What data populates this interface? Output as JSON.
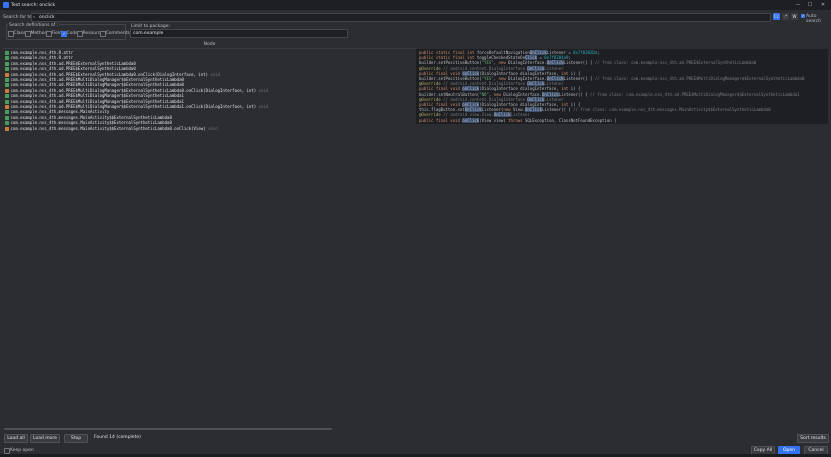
{
  "window": {
    "title": "Text search: onclick",
    "minimize": "—",
    "maximize": "☐",
    "close": "✕"
  },
  "search": {
    "label": "Search for text:",
    "value": "onclick",
    "case_btn": "Cc",
    "regex_btn": ".*",
    "words_btn": "W",
    "auto_search_label": "Auto search",
    "auto_search_checked": true
  },
  "definitions": {
    "legend": "Search definitions of :",
    "options": [
      {
        "label": "Class",
        "checked": false
      },
      {
        "label": "Method",
        "checked": false
      },
      {
        "label": "Field",
        "checked": false
      },
      {
        "label": "Code",
        "checked": true
      },
      {
        "label": "Resource",
        "checked": false
      },
      {
        "label": "Comments",
        "checked": false
      }
    ]
  },
  "package_filter": {
    "label": "Limit to package:",
    "value": "com.example"
  },
  "results": {
    "column_header": "Node",
    "rows": [
      {
        "name": "com.example.nss_4th.R.attr",
        "sig": "",
        "icon_color": "#4a9c5d"
      },
      {
        "name": "com.example.nss_4th.R.attr",
        "sig": "",
        "icon_color": "#4a9c5d"
      },
      {
        "name": "com.example.nss_4th.ad.PREE$ExternalSyntheticLambda0",
        "sig": "",
        "icon_color": "#4a9c5d"
      },
      {
        "name": "com.example.nss_4th.ad.PREE$ExternalSyntheticLambda0",
        "sig": "",
        "icon_color": "#4a9c5d"
      },
      {
        "name": "com.example.nss_4th.ad.PREE$ExternalSyntheticLambda0.onClick(DialogInterface, int)",
        "sig": "void",
        "icon_color": "#c77c3a"
      },
      {
        "name": "com.example.nss_4th.ad.PREE$MultiDialogManager$$ExternalSyntheticLambda0",
        "sig": "",
        "icon_color": "#4a9c5d"
      },
      {
        "name": "com.example.nss_4th.ad.PREE$MultiDialogManager$$ExternalSyntheticLambda0",
        "sig": "",
        "icon_color": "#4a9c5d"
      },
      {
        "name": "com.example.nss_4th.ad.PREE$MultiDialogManager$$ExternalSyntheticLambda0.onClick(DialogInterface, int)",
        "sig": "void",
        "icon_color": "#c77c3a"
      },
      {
        "name": "com.example.nss_4th.ad.PREE$MultiDialogManager$$ExternalSyntheticLambda1",
        "sig": "",
        "icon_color": "#4a9c5d"
      },
      {
        "name": "com.example.nss_4th.ad.PREE$MultiDialogManager$$ExternalSyntheticLambda1",
        "sig": "",
        "icon_color": "#4a9c5d"
      },
      {
        "name": "com.example.nss_4th.ad.PREE$MultiDialogManager$$ExternalSyntheticLambda1.onClick(DialogInterface, int)",
        "sig": "void",
        "icon_color": "#c77c3a"
      },
      {
        "name": "com.example.nss_4th.messages.MainActivity",
        "sig": "",
        "icon_color": "#4a9c5d"
      },
      {
        "name": "com.example.nss_4th.messages.MainActivity$$ExternalSyntheticLambda0",
        "sig": "",
        "icon_color": "#4a9c5d"
      },
      {
        "name": "com.example.nss_4th.messages.MainActivity$$ExternalSyntheticLambda0",
        "sig": "",
        "icon_color": "#4a9c5d"
      },
      {
        "name": "com.example.nss_4th.messages.MainActivity$$ExternalSyntheticLambda0.onClick(View)",
        "sig": "void",
        "icon_color": "#c77c3a"
      }
    ]
  },
  "code_preview": {
    "lines": [
      [
        {
          "t": "public static final ",
          "c": "kw"
        },
        {
          "t": "int ",
          "c": "kw"
        },
        {
          "t": "forceDefaultNavigation",
          "c": ""
        },
        {
          "t": "OnClick",
          "c": "hl"
        },
        {
          "t": "Listener = ",
          "c": ""
        },
        {
          "t": "0x7f0302Da",
          "c": "num"
        },
        {
          "t": ";",
          "c": ""
        }
      ],
      [
        {
          "t": "public static final ",
          "c": "kw"
        },
        {
          "t": "int ",
          "c": "kw"
        },
        {
          "t": "toggleCheckedStateOn",
          "c": ""
        },
        {
          "t": "Click",
          "c": "hl"
        },
        {
          "t": " = ",
          "c": ""
        },
        {
          "t": "0x7f0304a9",
          "c": "num"
        },
        {
          "t": ";",
          "c": ""
        }
      ],
      [
        {
          "t": "builder.setPositiveButton(",
          "c": ""
        },
        {
          "t": "\"YES\"",
          "c": "str"
        },
        {
          "t": ", ",
          "c": ""
        },
        {
          "t": "new ",
          "c": "kw"
        },
        {
          "t": "DialogInterface.",
          "c": ""
        },
        {
          "t": "OnClick",
          "c": "hl"
        },
        {
          "t": "Listener() { ",
          "c": ""
        },
        {
          "t": "// from class: com.example.nss_4th.ad.PREE$ExternalSyntheticLambda0",
          "c": "cm"
        }
      ],
      [
        {
          "t": "@Override ",
          "c": "ann"
        },
        {
          "t": "// android.content.DialogInterface.",
          "c": "cm"
        },
        {
          "t": "OnClick",
          "c": "hl"
        },
        {
          "t": "Listener",
          "c": "cm"
        }
      ],
      [
        {
          "t": "public final void ",
          "c": "kw"
        },
        {
          "t": "onClick",
          "c": "hl"
        },
        {
          "t": "(DialogInterface dialogInterface, ",
          "c": ""
        },
        {
          "t": "int ",
          "c": "kw"
        },
        {
          "t": "i) {",
          "c": ""
        }
      ],
      [
        {
          "t": "builder.setPositiveButton(",
          "c": ""
        },
        {
          "t": "\"YES\"",
          "c": "str"
        },
        {
          "t": ", ",
          "c": ""
        },
        {
          "t": "new ",
          "c": "kw"
        },
        {
          "t": "DialogInterface.",
          "c": ""
        },
        {
          "t": "OnClick",
          "c": "hl"
        },
        {
          "t": "Listener() { ",
          "c": ""
        },
        {
          "t": "// from class: com.example.nss_4th.ad.PREE$MultiDialogManager$$ExternalSyntheticLambda0",
          "c": "cm"
        }
      ],
      [
        {
          "t": "@Override ",
          "c": "ann"
        },
        {
          "t": "// android.content.DialogInterface.",
          "c": "cm"
        },
        {
          "t": "OnClick",
          "c": "hl"
        },
        {
          "t": "Listener",
          "c": "cm"
        }
      ],
      [
        {
          "t": "public final void ",
          "c": "kw"
        },
        {
          "t": "onClick",
          "c": "hl"
        },
        {
          "t": "(DialogInterface dialogInterface, ",
          "c": ""
        },
        {
          "t": "int ",
          "c": "kw"
        },
        {
          "t": "i) {",
          "c": ""
        }
      ],
      [
        {
          "t": "builder.setNeutralButton(",
          "c": ""
        },
        {
          "t": "\"NO\"",
          "c": "str"
        },
        {
          "t": ", ",
          "c": ""
        },
        {
          "t": "new ",
          "c": "kw"
        },
        {
          "t": "DialogInterface.",
          "c": ""
        },
        {
          "t": "OnClick",
          "c": "hl"
        },
        {
          "t": "Listener() { ",
          "c": ""
        },
        {
          "t": "// from class: com.example.nss_4th.ad.PREE$MultiDialogManager$$ExternalSyntheticLambda1",
          "c": "cm"
        }
      ],
      [
        {
          "t": "@Override ",
          "c": "ann"
        },
        {
          "t": "// android.content.DialogInterface.",
          "c": "cm"
        },
        {
          "t": "OnClick",
          "c": "hl"
        },
        {
          "t": "Listener",
          "c": "cm"
        }
      ],
      [
        {
          "t": "public final void ",
          "c": "kw"
        },
        {
          "t": "onClick",
          "c": "hl"
        },
        {
          "t": "(DialogInterface dialogInterface, ",
          "c": ""
        },
        {
          "t": "int ",
          "c": "kw"
        },
        {
          "t": "i) {",
          "c": ""
        }
      ],
      [
        {
          "t": "this.flagButton.set",
          "c": ""
        },
        {
          "t": "OnClick",
          "c": "hl"
        },
        {
          "t": "Listener(",
          "c": ""
        },
        {
          "t": "new ",
          "c": "kw"
        },
        {
          "t": "View.",
          "c": ""
        },
        {
          "t": "OnClick",
          "c": "hl"
        },
        {
          "t": "Listener() { ",
          "c": ""
        },
        {
          "t": "// from class: com.example.nss_4th.messages.MainActivity$$ExternalSyntheticLambda0",
          "c": "cm"
        }
      ],
      [
        {
          "t": "@Override ",
          "c": "ann"
        },
        {
          "t": "// android.view.View.",
          "c": "cm"
        },
        {
          "t": "OnClick",
          "c": "hl"
        },
        {
          "t": "Listener",
          "c": "cm"
        }
      ],
      [
        {
          "t": "public final void ",
          "c": "kw"
        },
        {
          "t": "onClick",
          "c": "hl"
        },
        {
          "t": "(View view) ",
          "c": ""
        },
        {
          "t": "throws ",
          "c": "kw"
        },
        {
          "t": "SQLException, ClassNotFoundException {",
          "c": ""
        }
      ]
    ]
  },
  "bottom_bar": {
    "load_all": "Load all",
    "load_more": "Load more",
    "stop": "Stop",
    "status": "Found 14 (complete)",
    "sort_results": "Sort results"
  },
  "footer": {
    "keep_open": "Keep open",
    "copy_all": "Copy All",
    "open": "Open",
    "cancel": "Cancel"
  },
  "colors": {
    "accent": "#3574f0",
    "background": "#2b2d30",
    "editor_bg": "#1e1f22"
  }
}
